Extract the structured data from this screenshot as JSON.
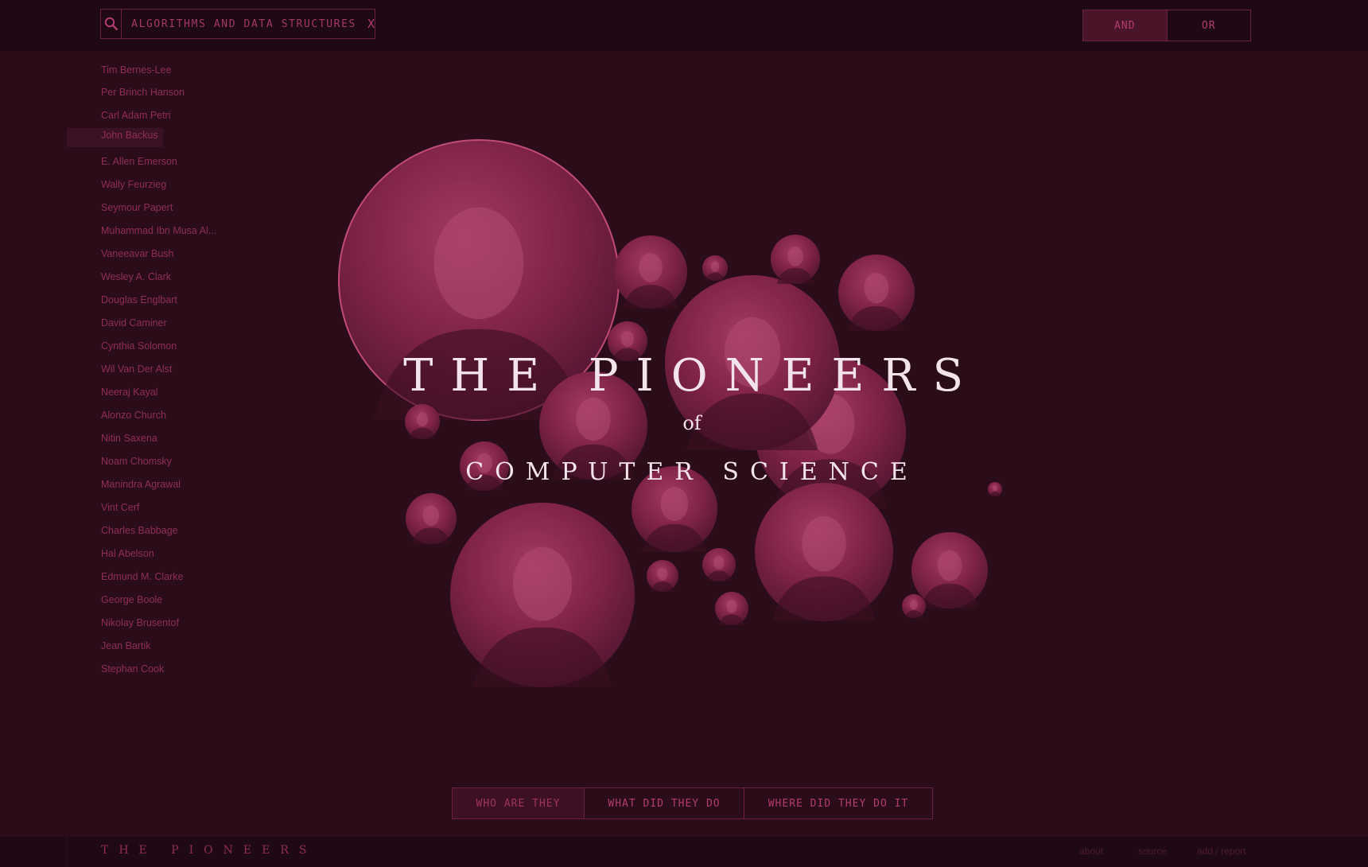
{
  "search": {
    "query": "ALGORITHMS AND DATA STRUCTURES",
    "clear_label": "X",
    "icon": "search-icon"
  },
  "filter_mode": {
    "options": [
      "AND",
      "OR"
    ],
    "selected": "AND"
  },
  "pioneers": [
    "Tim Bernes-Lee",
    "Per Brinch Hanson",
    "Carl Adam Petri",
    "John Backus",
    "E. Allen Emerson",
    "Wally Feurzieg",
    "Seymour Papert",
    "Muhammad Ibn Musa Al...",
    "Vaneeavar Bush",
    "Wesley A. Clark",
    "Douglas Englbart",
    "David Caminer",
    "Cynthia Solomon",
    "Wil Van Der Alst",
    "Neeraj Kayal",
    "Alonzo Church",
    "Nitin Saxena",
    "Noam Chomsky",
    "Manindra Agrawal",
    "Vint Cerf",
    "Charles Babbage",
    "Hal Abelson",
    "Edmund M. Clarke",
    "George Boole",
    "Nikolay Brusentof",
    "Jean Bartik",
    "Stephan Cook"
  ],
  "highlighted_pioneer": "John Backus",
  "hero": {
    "title": "THE PIONEERS",
    "of": "of",
    "subtitle": "COMPUTER SCIENCE"
  },
  "tabs": [
    {
      "label": "WHO ARE THEY",
      "active": true
    },
    {
      "label": "WHAT DID THEY DO",
      "active": false
    },
    {
      "label": "WHERE DID THEY DO IT",
      "active": false
    }
  ],
  "footer": {
    "logo": "THE PIONEERS",
    "links": [
      "about",
      "source",
      "add / report"
    ]
  },
  "colors": {
    "background": "#2b0d1a",
    "bar": "#1f0914",
    "accent": "#b23b70",
    "text_light": "#f2e4ea"
  }
}
